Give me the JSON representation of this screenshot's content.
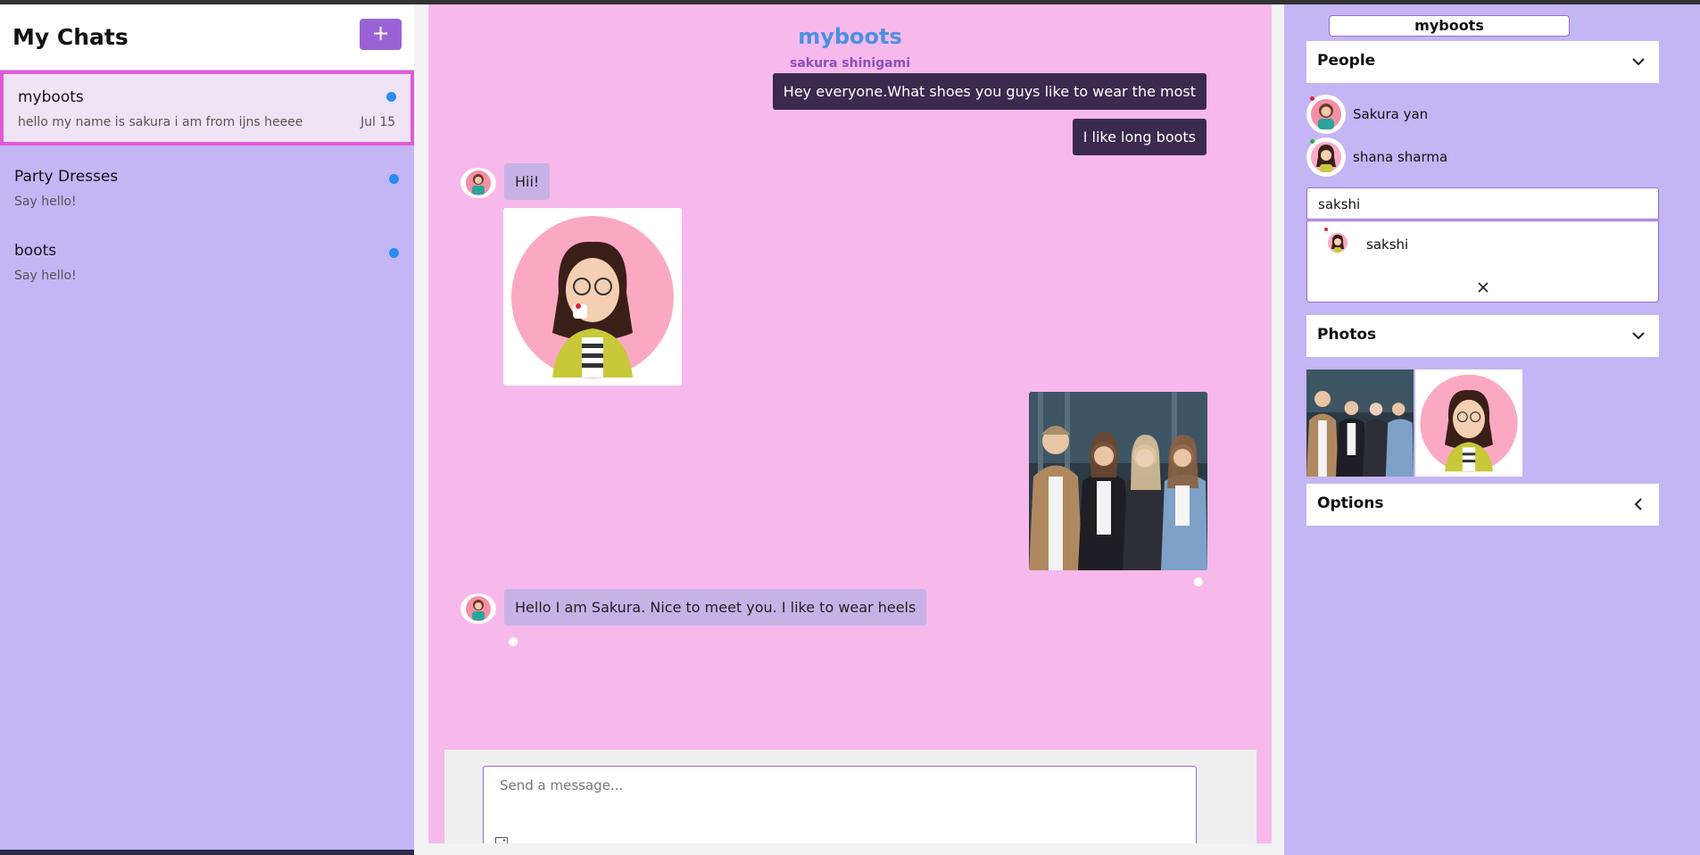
{
  "left_panel": {
    "title": "My Chats",
    "new_chat_label": "+",
    "chats": [
      {
        "name": "myboots",
        "preview": "hello my name is sakura i am from ijns heeee",
        "date": "Jul 15",
        "unread": true,
        "active": true
      },
      {
        "name": "Party Dresses",
        "preview": "Say hello!",
        "date": "",
        "unread": true,
        "active": false
      },
      {
        "name": "boots",
        "preview": "Say hello!",
        "date": "",
        "unread": true,
        "active": false
      }
    ]
  },
  "chat": {
    "title": "myboots",
    "subtitle": "sakura shinigami",
    "messages": [
      {
        "direction": "out",
        "text": "Hey everyone.What shoes you guys like to wear the most"
      },
      {
        "direction": "out",
        "text": "I like long boots"
      },
      {
        "direction": "in",
        "text": "Hii!"
      },
      {
        "direction": "in",
        "type": "image",
        "image": "avatar-sakura"
      },
      {
        "direction": "out",
        "type": "image",
        "image": "group-photo"
      },
      {
        "direction": "in",
        "text": "Hello I am Sakura. Nice to meet you. I like to wear heels"
      }
    ],
    "composer_placeholder": "Send a message...",
    "composer_icon": "image-icon"
  },
  "right_panel": {
    "chat_name": "myboots",
    "people_section": "People",
    "people": [
      {
        "name": "Sakura yan",
        "status_color": "#e0203a"
      },
      {
        "name": "shana sharma",
        "status_color": "#2ea84a"
      }
    ],
    "search_value": "sakshi",
    "search_results": [
      {
        "name": "sakshi",
        "status_color": "#e0203a"
      }
    ],
    "close_icon": "close-icon",
    "photos_section": "Photos",
    "options_section": "Options"
  },
  "colors": {
    "panel_bg": "#c4b5f5",
    "chat_bg": "#f7b9ec",
    "accent_purple": "#9b62d6",
    "outgoing_bubble": "#3b2a4d",
    "incoming_bubble": "#c7b2e6",
    "title_blue": "#4a90e2",
    "unread_dot": "#2a8cf5",
    "active_border": "#e05bd8"
  }
}
